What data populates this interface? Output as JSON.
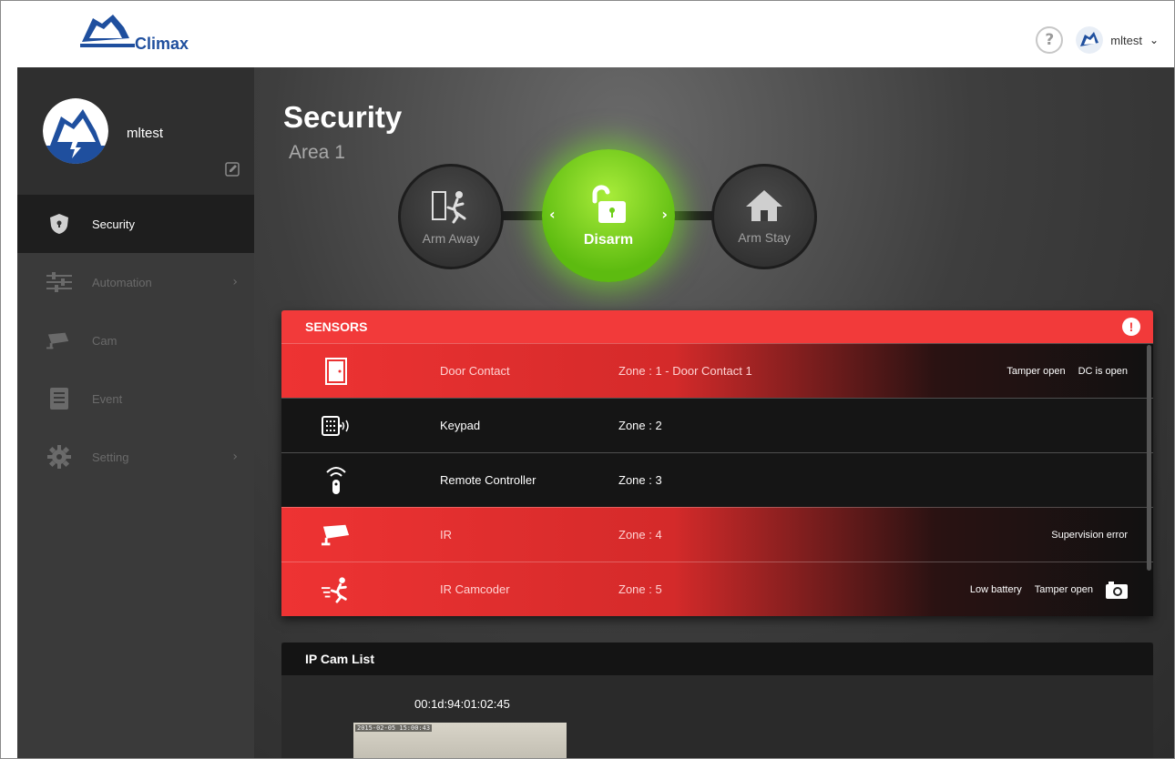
{
  "brand": {
    "name": "Climax"
  },
  "header": {
    "username": "mltest",
    "help_symbol": "?"
  },
  "profile": {
    "username": "mltest"
  },
  "sidebar": {
    "items": [
      {
        "label": "Security",
        "icon": "shield-icon",
        "active": true
      },
      {
        "label": "Automation",
        "icon": "sliders-icon",
        "has_arrow": true
      },
      {
        "label": "Cam",
        "icon": "camera-icon"
      },
      {
        "label": "Event",
        "icon": "list-icon"
      },
      {
        "label": "Setting",
        "icon": "gear-icon",
        "has_arrow": true
      }
    ],
    "arrow": "›"
  },
  "main": {
    "title": "Security",
    "area": "Area 1"
  },
  "modes": {
    "arm_away": "Arm Away",
    "disarm": "Disarm",
    "arm_stay": "Arm Stay",
    "left_arrow": "‹",
    "right_arrow": "›",
    "selected": "Disarm"
  },
  "sensors": {
    "title": "SENSORS",
    "alert_symbol": "!",
    "rows": [
      {
        "name": "Door Contact",
        "zone": "Zone : 1 - Door Contact 1",
        "status": [
          "Tamper open",
          "DC is open"
        ],
        "state": "alert",
        "icon": "door-icon"
      },
      {
        "name": "Keypad",
        "zone": "Zone : 2",
        "status": [],
        "state": "normal",
        "icon": "keypad-icon"
      },
      {
        "name": "Remote Controller",
        "zone": "Zone : 3",
        "status": [],
        "state": "normal",
        "icon": "remote-icon"
      },
      {
        "name": "IR",
        "zone": "Zone : 4",
        "status": [
          "Supervision error"
        ],
        "state": "alert",
        "icon": "ir-camera-icon"
      },
      {
        "name": "IR Camcoder",
        "zone": "Zone : 5",
        "status": [
          "Low battery",
          "Tamper open"
        ],
        "state": "alert",
        "icon": "running-man-icon",
        "has_camera": true
      }
    ]
  },
  "ipcam": {
    "title": "IP Cam List",
    "mac": "00:1d:94:01:02:45",
    "thumb_timestamp": "2015-02-05 15:00:43"
  },
  "colors": {
    "accent_red": "#f23a3a",
    "accent_green": "#6fcf1a",
    "brand_blue": "#1f4f9e"
  }
}
